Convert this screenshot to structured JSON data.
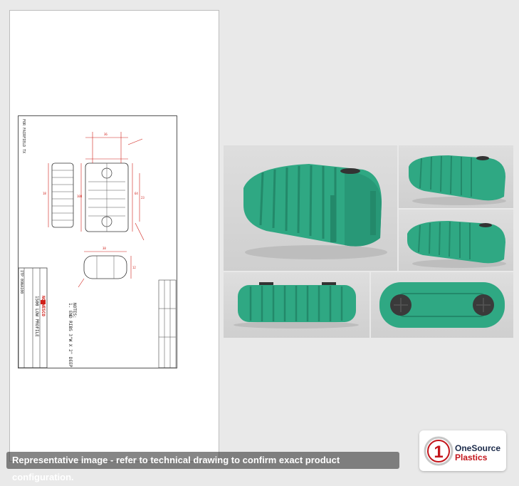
{
  "drawing": {
    "brand": "NORWESCO",
    "title": "1500 LOW PROFILE",
    "notes_heading": "NOTES:",
    "note_1": "1. END RIBS 3\"W X 2\" DEEP",
    "side_label": "FOR FAIRFIELD TX",
    "part_number": "ITP 09NA100"
  },
  "photos": [
    {
      "view": "three-quarter-large",
      "color": "#2fa883"
    },
    {
      "view": "three-quarter-small-top",
      "color": "#2fa883"
    },
    {
      "view": "three-quarter-small-bottom",
      "color": "#2fa883"
    },
    {
      "view": "side",
      "color": "#2fa883"
    },
    {
      "view": "top",
      "color": "#2fa883"
    }
  ],
  "caption": "Representative image - refer to technical drawing to confirm exact product configuration.",
  "logo": {
    "numeral": "1",
    "line1": "OneSource",
    "line2": "Plastics",
    "colors": {
      "navy": "#1b2a4a",
      "red": "#c3161c"
    }
  }
}
